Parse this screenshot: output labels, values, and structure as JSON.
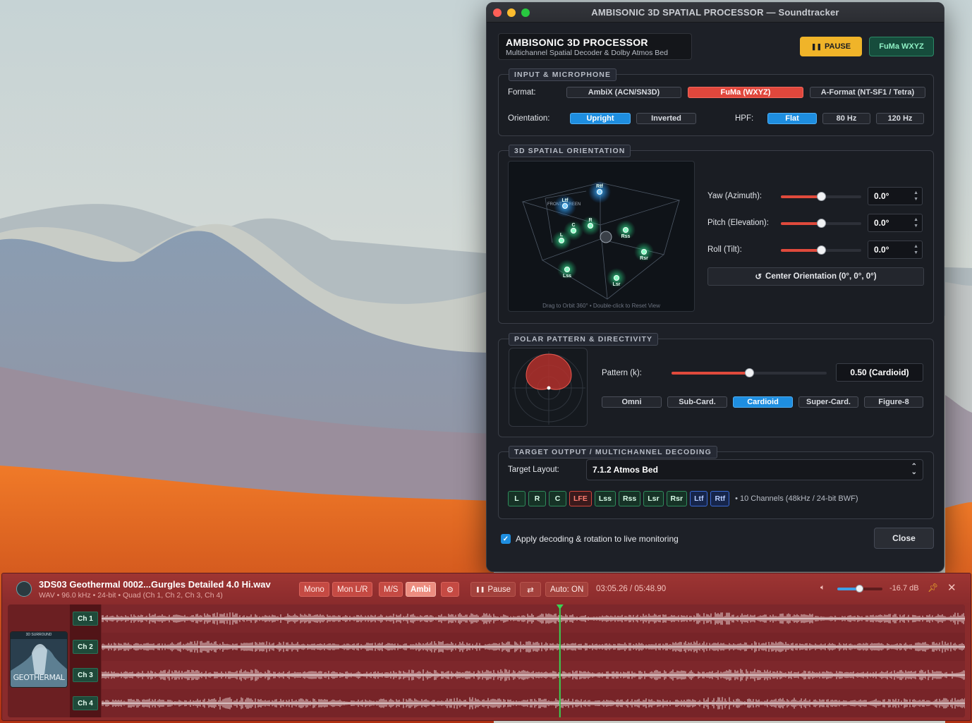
{
  "window": {
    "title": "AMBISONIC 3D SPATIAL PROCESSOR — Soundtracker"
  },
  "header": {
    "title": "AMBISONIC 3D PROCESSOR",
    "subtitle": "Multichannel Spatial Decoder & Dolby Atmos Bed",
    "pause_label": "PAUSE",
    "format_badge": "FuMa WXYZ"
  },
  "input": {
    "section_label": "INPUT & MICROPHONE",
    "format_label": "Format:",
    "formats": [
      "AmbiX (ACN/SN3D)",
      "FuMa (WXYZ)",
      "A-Format (NT-SF1 / Tetra)"
    ],
    "format_selected": "FuMa (WXYZ)",
    "orientation_label": "Orientation:",
    "orientations": [
      "Upright",
      "Inverted"
    ],
    "orientation_selected": "Upright",
    "hpf_label": "HPF:",
    "hpf_options": [
      "Flat",
      "80 Hz",
      "120 Hz"
    ],
    "hpf_selected": "Flat"
  },
  "spatial": {
    "section_label": "3D SPATIAL ORIENTATION",
    "view_hint": "Drag to Orbit 360° • Double-click to Reset View",
    "front_label": "FRONT SCREEN",
    "speakers": [
      "Ltf",
      "Rtf",
      "L",
      "C",
      "R",
      "Rss",
      "Rsr",
      "Lss",
      "Lsr"
    ],
    "yaw_label": "Yaw (Azimuth):",
    "yaw_value": "0.0°",
    "yaw_level": 0.5,
    "pitch_label": "Pitch (Elevation):",
    "pitch_value": "0.0°",
    "pitch_level": 0.5,
    "roll_label": "Roll (Tilt):",
    "roll_value": "0.0°",
    "roll_level": 0.5,
    "center_button": "Center Orientation (0°, 0°, 0°)"
  },
  "polar": {
    "section_label": "POLAR PATTERN & DIRECTIVITY",
    "pattern_label": "Pattern (k):",
    "pattern_value": "0.50 (Cardioid)",
    "pattern_level": 0.5,
    "options": [
      "Omni",
      "Sub-Card.",
      "Cardioid",
      "Super-Card.",
      "Figure-8"
    ],
    "selected": "Cardioid"
  },
  "output": {
    "section_label": "TARGET OUTPUT / MULTICHANNEL DECODING",
    "layout_label": "Target Layout:",
    "layout_value": "7.1.2 Atmos Bed",
    "channels": [
      {
        "name": "L",
        "kind": "bed"
      },
      {
        "name": "R",
        "kind": "bed"
      },
      {
        "name": "C",
        "kind": "bed"
      },
      {
        "name": "LFE",
        "kind": "lfe"
      },
      {
        "name": "Lss",
        "kind": "bed"
      },
      {
        "name": "Rss",
        "kind": "bed"
      },
      {
        "name": "Lsr",
        "kind": "bed"
      },
      {
        "name": "Rsr",
        "kind": "bed"
      },
      {
        "name": "Ltf",
        "kind": "height"
      },
      {
        "name": "Rtf",
        "kind": "height"
      }
    ],
    "channels_note": "• 10 Channels (48kHz / 24-bit BWF)"
  },
  "footer": {
    "apply_label": "Apply decoding & rotation to live monitoring",
    "apply_checked": true,
    "close_label": "Close"
  },
  "player": {
    "file_title": "3DS03 Geothermal 0002...Gurgles Detailed 4.0 Hi.wav",
    "file_meta": "WAV • 96.0 kHz • 24-bit • Quad (Ch 1, Ch 2, Ch 3, Ch 4)",
    "modes": [
      "Mono",
      "Mon L/R",
      "M/S",
      "Ambi"
    ],
    "mode_selected": "Ambi",
    "settings_glyph": "⚙",
    "pause_label": "Pause",
    "auto_label": "Auto: ON",
    "time": "03:05.26 / 05:48.90",
    "playhead_fraction": 0.53,
    "volume_db": "-16.7 dB",
    "volume_level": 0.5,
    "channel_tags": [
      "Ch 1",
      "Ch 2",
      "Ch 3",
      "Ch 4"
    ],
    "cover_brand": "3D SURROUND",
    "cover_title": "GEOTHERMAL"
  },
  "colors": {
    "accent_red": "#e0473c",
    "accent_blue": "#1e8ee0",
    "pause_yellow": "#f0b429",
    "player_bg": "#8a2b2c"
  }
}
